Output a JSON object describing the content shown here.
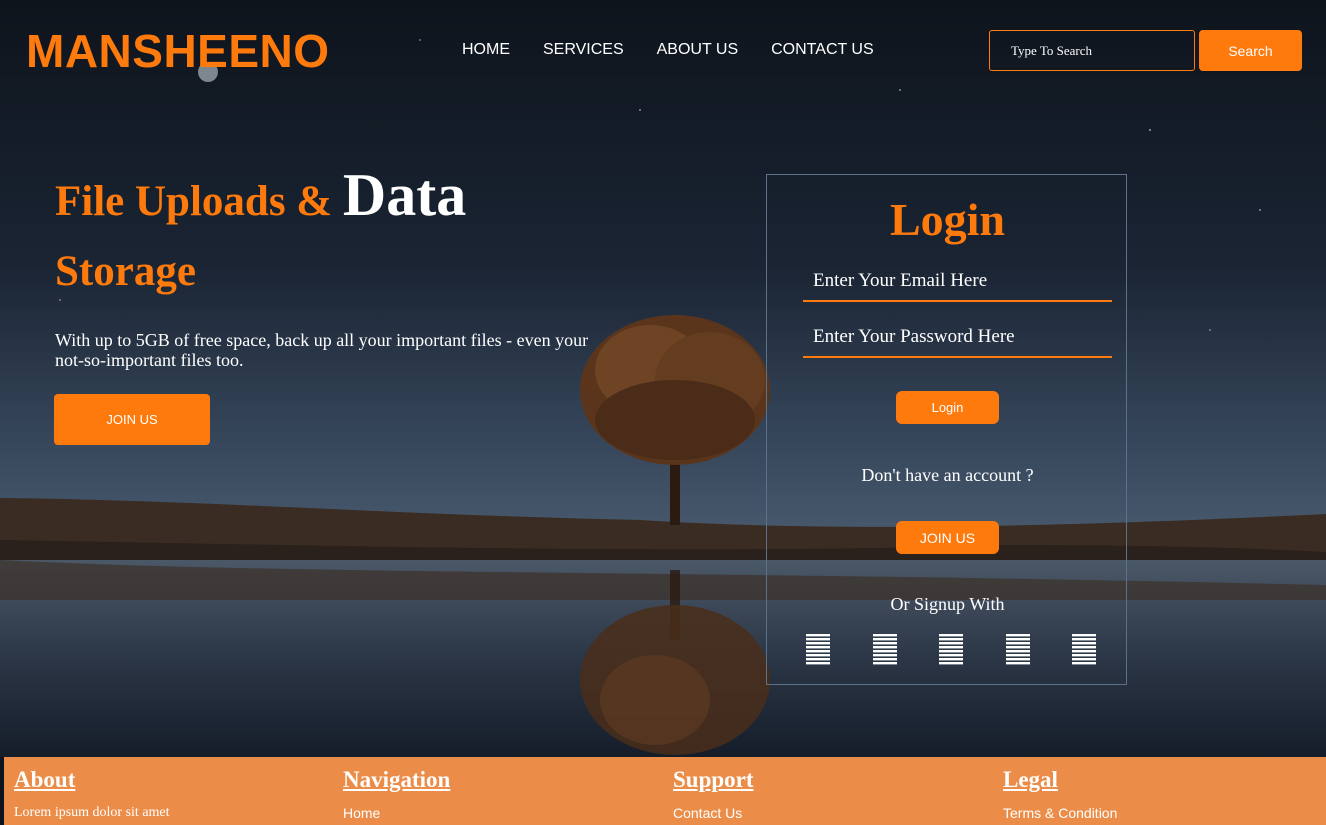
{
  "brand": "MANSHEENO",
  "nav": {
    "items": [
      "HOME",
      "SERVICES",
      "ABOUT US",
      "CONTACT US"
    ]
  },
  "search": {
    "placeholder": "Type To Search",
    "button": "Search"
  },
  "hero": {
    "title_orange": "File Uploads & ",
    "title_white": "Data",
    "title_orange2": "Storage",
    "text": "With up to 5GB of free space, back up all your important files - even your not-so-important files too.",
    "join_button": "JOIN US"
  },
  "login": {
    "title": "Login",
    "email_placeholder": "Enter Your Email Here",
    "password_placeholder": "Enter Your Password Here",
    "login_button": "Login",
    "account_prompt": "Don't have an account ?",
    "join_button": "JOIN US",
    "signup_with": "Or Signup With",
    "social_icons": [
      "social-icon-1",
      "social-icon-2",
      "social-icon-3",
      "social-icon-4",
      "social-icon-5"
    ]
  },
  "footer": {
    "columns": [
      {
        "heading": "About",
        "item": "Lorem ipsum dolor sit amet"
      },
      {
        "heading": "Navigation",
        "item": "Home"
      },
      {
        "heading": "Support",
        "item": "Contact Us"
      },
      {
        "heading": "Legal",
        "item": "Terms & Condition"
      }
    ]
  },
  "colors": {
    "accent": "#ff7a0d",
    "footer": "#eb8d48",
    "sky": "#0d1420"
  }
}
